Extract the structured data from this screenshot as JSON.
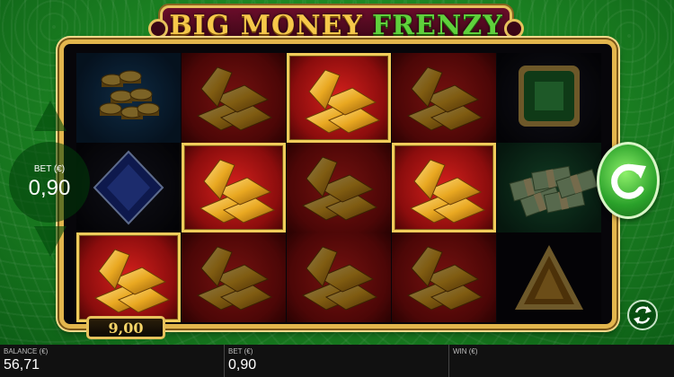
{
  "game": {
    "title_part1": "BIG MONEY",
    "title_part2": "FRENZY"
  },
  "bet_panel": {
    "label": "BET (€)",
    "value": "0,90"
  },
  "win_plaque": "9,00",
  "bottom_bar": {
    "balance_label": "BALANCE (€)",
    "balance_value": "56,71",
    "bet_label": "BET (€)",
    "bet_value": "0,90",
    "win_label": "WIN (€)",
    "win_value": ""
  },
  "reels": [
    [
      "coins",
      "sapphire",
      "gold"
    ],
    [
      "gold",
      "gold",
      "gold"
    ],
    [
      "gold",
      "gold",
      "gold"
    ],
    [
      "gold",
      "gold",
      "gold"
    ],
    [
      "emerald",
      "cash",
      "topaz"
    ]
  ],
  "winning_cells": [
    [
      0,
      2
    ],
    [
      1,
      1
    ],
    [
      2,
      0
    ],
    [
      3,
      1
    ]
  ],
  "colors": {
    "frame_gold": "#e3b64d",
    "background_green": "#1f8a25",
    "title_gold": "#f6c84a",
    "title_green": "#5fd13c"
  }
}
